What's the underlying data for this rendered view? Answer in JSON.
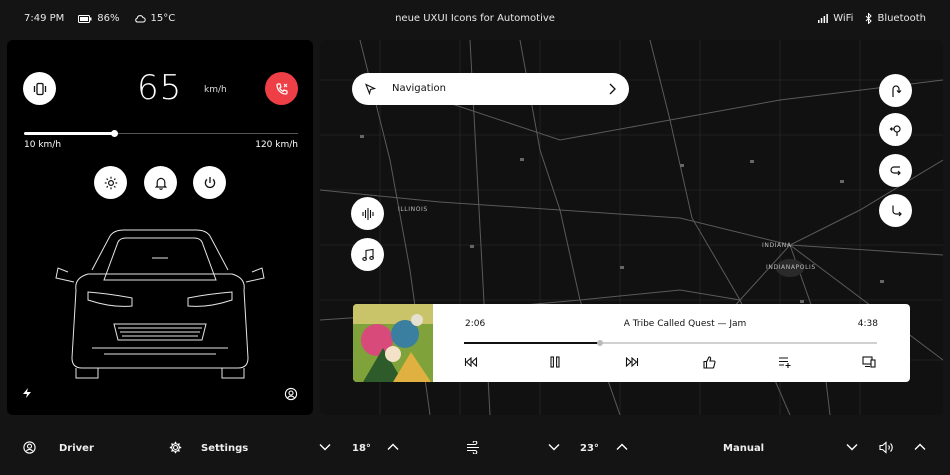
{
  "status_bar": {
    "time": "7:49 PM",
    "battery": "86%",
    "temperature": "15°C",
    "title": "neue UXUI Icons for Automotive",
    "wifi": "WiFi",
    "bluetooth": "Bluetooth"
  },
  "dashboard": {
    "speed": "65",
    "speed_unit": "km/h",
    "range_min": "10 km/h",
    "range_max": "120 km/h",
    "slider_fraction": 0.33
  },
  "navigation": {
    "label": "Navigation",
    "map_labels": [
      "ILLINOIS",
      "INDIANA",
      "INDIANAPOLIS"
    ]
  },
  "player": {
    "elapsed": "2:06",
    "title": "A Tribe Called Quest — Jam",
    "duration": "4:38",
    "progress_fraction": 0.33
  },
  "bottom_bar": {
    "driver_label": "Driver",
    "settings_label": "Settings",
    "left_temp": "18°",
    "right_temp": "23°",
    "mode_label": "Manual"
  },
  "colors": {
    "accent_red": "#ef3f46",
    "panel_bg": "#000000",
    "app_bg": "#141414"
  }
}
